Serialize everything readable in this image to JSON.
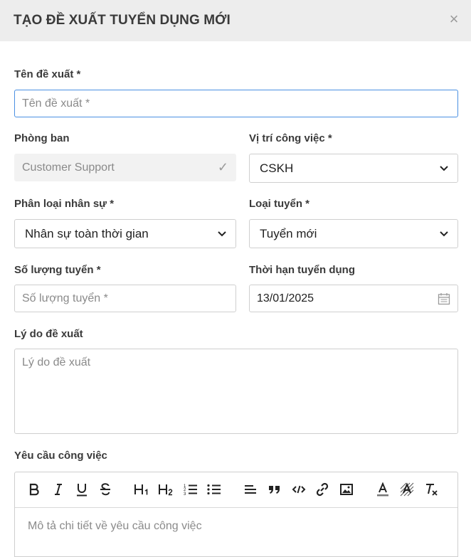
{
  "dialog": {
    "title": "TẠO ĐỀ XUẤT TUYỂN DỤNG MỚI",
    "close_label": "×"
  },
  "form": {
    "proposal_name": {
      "label": "Tên đề xuất *",
      "placeholder": "Tên đề xuất *",
      "value": ""
    },
    "department": {
      "label": "Phòng ban",
      "value": "Customer Support",
      "check": "✓"
    },
    "position": {
      "label": "Vị trí công việc *",
      "value": "CSKH"
    },
    "staff_type": {
      "label": "Phân loại nhân sự *",
      "value": "Nhân sự toàn thời gian"
    },
    "recruit_type": {
      "label": "Loại tuyển *",
      "value": "Tuyển mới"
    },
    "quantity": {
      "label": "Số lượng tuyển *",
      "placeholder": "Số lượng tuyển *",
      "value": ""
    },
    "deadline": {
      "label": "Thời hạn tuyển dụng",
      "value": "13/01/2025"
    },
    "reason": {
      "label": "Lý do đề xuất",
      "placeholder": "Lý do đề xuất"
    },
    "requirements": {
      "label": "Yêu cầu công việc",
      "placeholder": "Mô tả chi tiết về yêu cầu công việc",
      "toolbar": [
        "bold",
        "italic",
        "underline",
        "strikethrough",
        "heading-1",
        "heading-2",
        "ordered-list",
        "bullet-list",
        "align",
        "blockquote",
        "code",
        "link",
        "image",
        "text-color",
        "highlight",
        "clear-format"
      ]
    }
  },
  "colors": {
    "header_bg": "#ededed",
    "focus_border": "#4a90e2",
    "border": "#cfcfcf"
  }
}
